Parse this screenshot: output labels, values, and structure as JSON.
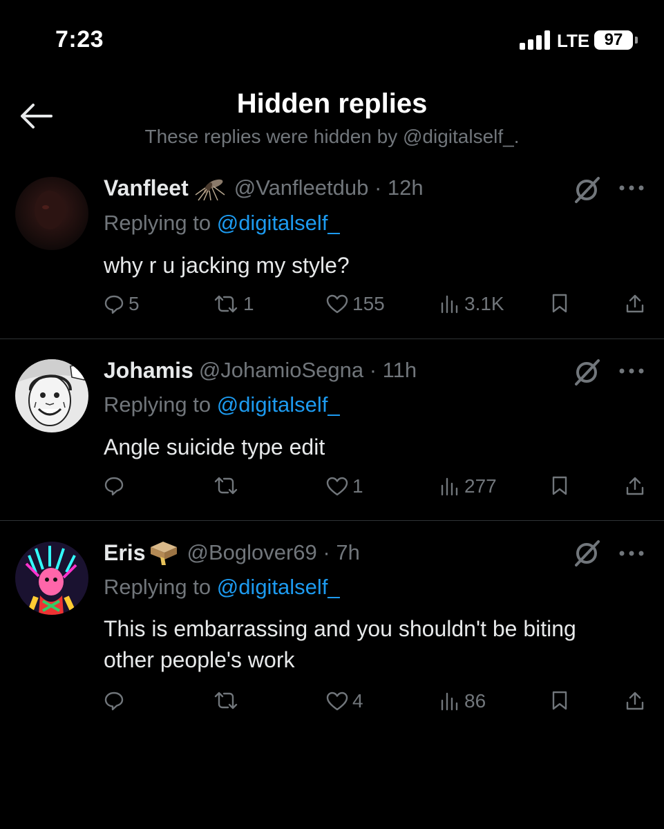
{
  "status_bar": {
    "time": "7:23",
    "network": "LTE",
    "battery": "97"
  },
  "header": {
    "title": "Hidden replies",
    "subtitle": "These replies were hidden by @digitalself_."
  },
  "replies": [
    {
      "name": "Vanfleet",
      "badge_icon": "mosquito-icon",
      "handle_time": "@Vanfleetdub · 12h",
      "replying_label": "Replying to",
      "mention": "@digitalself_",
      "text": "why r u jacking my style?",
      "replies_count": "5",
      "reposts_count": "1",
      "likes_count": "155",
      "views_count": "3.1K"
    },
    {
      "name": "Johamis",
      "badge_icon": "",
      "handle_time": "@JohamioSegna · 11h",
      "replying_label": "Replying to",
      "mention": "@digitalself_",
      "text": "Angle suicide type edit",
      "replies_count": "",
      "reposts_count": "",
      "likes_count": "1",
      "views_count": "277"
    },
    {
      "name": "Eris",
      "badge_icon": "cardboard-box-icon",
      "handle_time": "@Boglover69 · 7h",
      "replying_label": "Replying to",
      "mention": "@digitalself_",
      "text": "This is embarrassing and you shouldn't be biting other people's work",
      "replies_count": "",
      "reposts_count": "",
      "likes_count": "4",
      "views_count": "86"
    }
  ],
  "colors": {
    "background": "#000000",
    "text_primary": "#e7e9ea",
    "text_secondary": "#71767b",
    "accent": "#1d9bf0",
    "divider": "#2f3336"
  }
}
